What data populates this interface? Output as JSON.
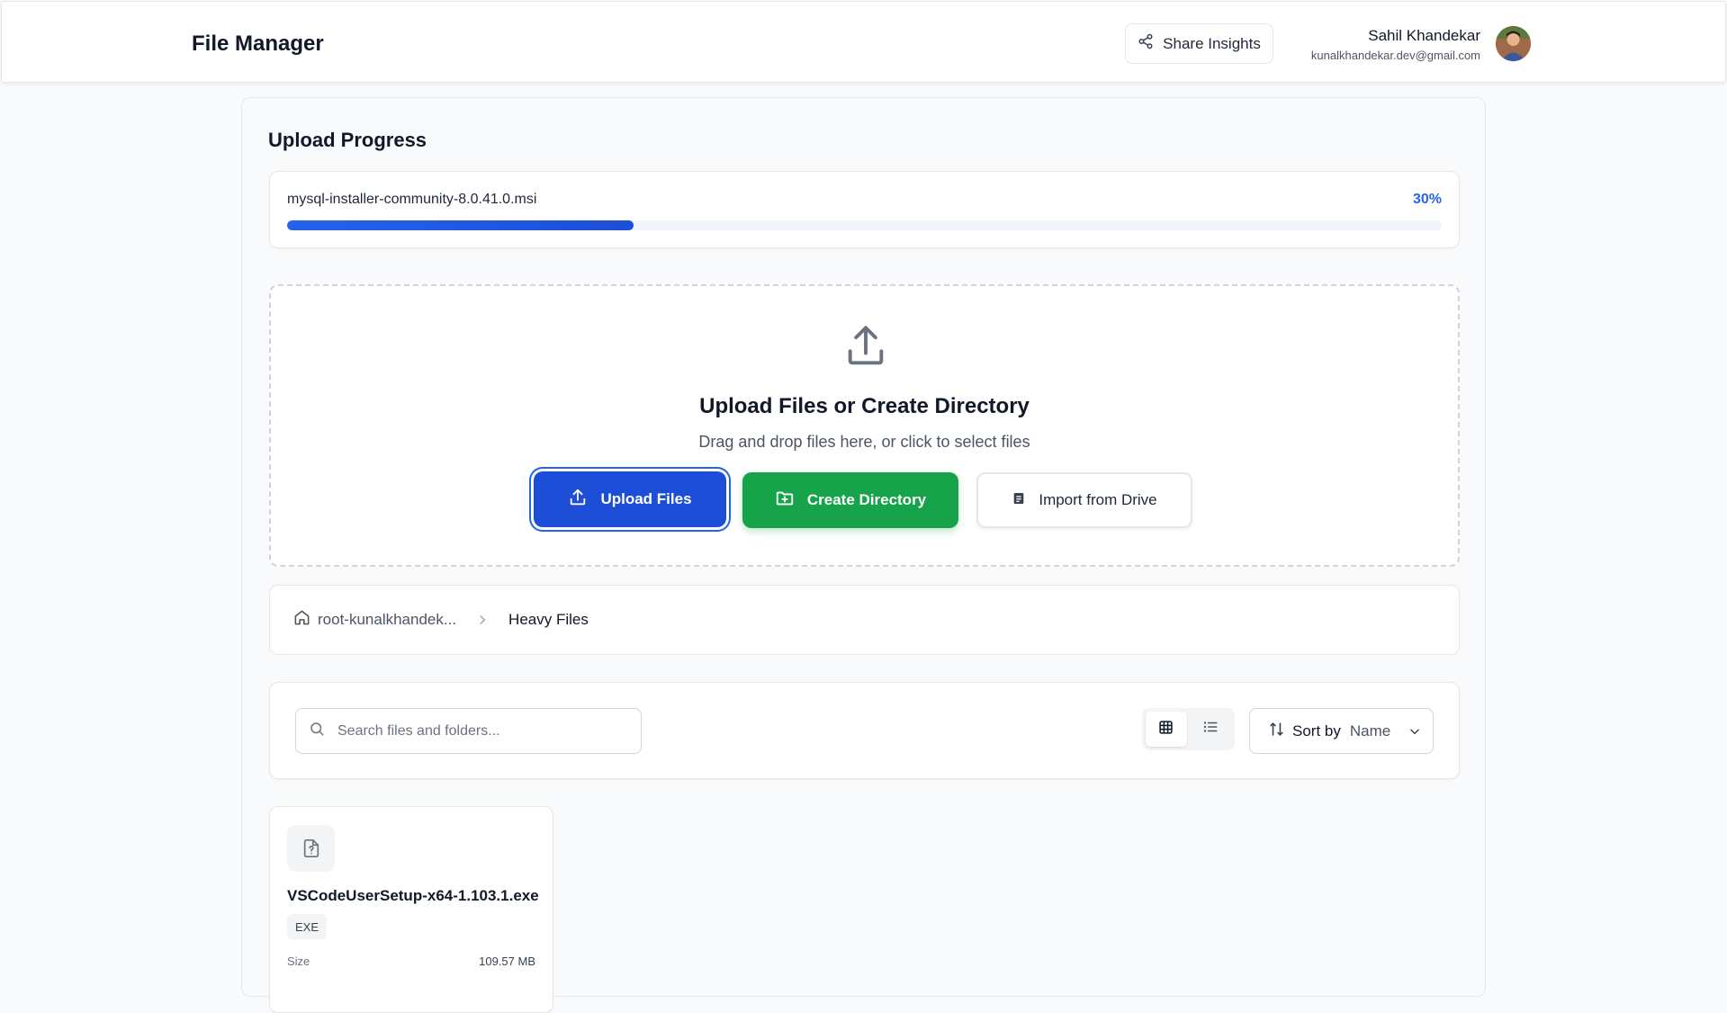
{
  "header": {
    "app_title": "File Manager",
    "share_label": "Share Insights",
    "user_name": "Sahil Khandekar",
    "user_email": "kunalkhandekar.dev@gmail.com"
  },
  "upload_progress": {
    "title": "Upload Progress",
    "file_name": "mysql-installer-community-8.0.41.0.msi",
    "percent_label": "30%",
    "percent": 30
  },
  "dropzone": {
    "title": "Upload Files or Create Directory",
    "subtitle": "Drag and drop files here, or click to select files",
    "upload_label": "Upload Files",
    "create_label": "Create Directory",
    "import_label": "Import from Drive"
  },
  "breadcrumb": {
    "root_label": "root-kunalkhandek...",
    "current_label": "Heavy Files"
  },
  "toolbar": {
    "search_placeholder": "Search files and folders...",
    "search_value": "",
    "sort_label": "Sort by",
    "sort_value": "Name",
    "view_mode": "grid"
  },
  "files": [
    {
      "name": "VSCodeUserSetup-x64-1.103.1.exe",
      "type_badge": "EXE",
      "size_label": "Size",
      "size_value": "109.57 MB"
    }
  ],
  "colors": {
    "primary": "#1d4ed8",
    "success": "#16a34a",
    "progress_text": "#2563eb"
  }
}
